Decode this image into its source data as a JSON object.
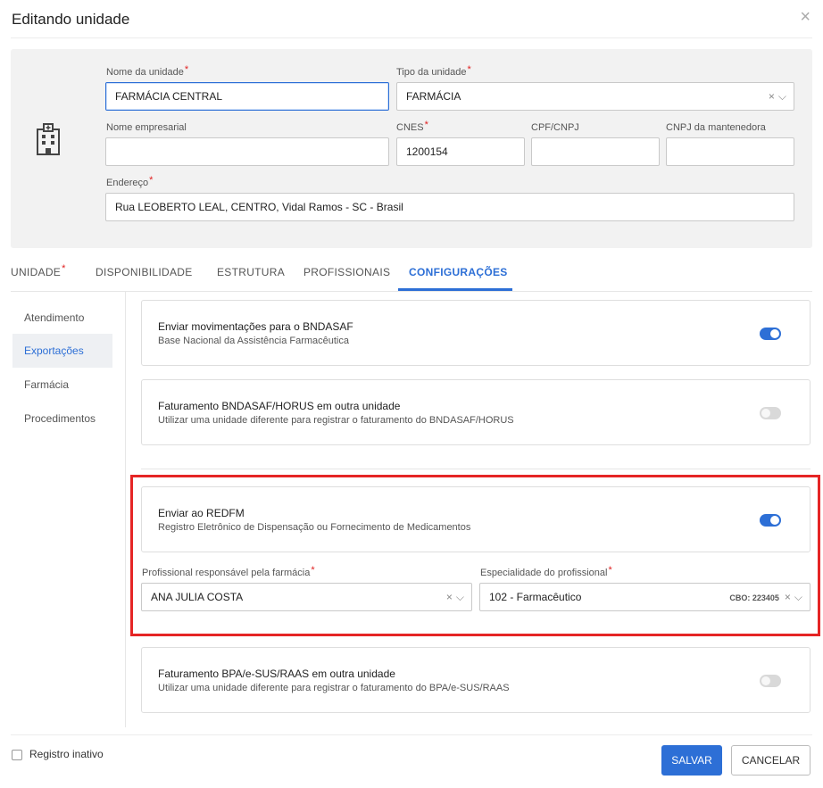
{
  "dialog": {
    "title": "Editando unidade",
    "close_glyph": "×"
  },
  "unit": {
    "icon": "hospital-building-icon",
    "nome_label": "Nome da unidade",
    "nome_value": "FARMÁCIA CENTRAL",
    "tipo_label": "Tipo da unidade",
    "tipo_value": "FARMÁCIA",
    "nome_empresarial_label": "Nome empresarial",
    "nome_empresarial_value": "",
    "cnes_label": "CNES",
    "cnes_value": "1200154",
    "cpf_cnpj_label": "CPF/CNPJ",
    "cpf_cnpj_value": "",
    "cnpj_mantenedora_label": "CNPJ da mantenedora",
    "cnpj_mantenedora_value": "",
    "endereco_label": "Endereço",
    "endereco_value": "Rua LEOBERTO LEAL, CENTRO, Vidal Ramos - SC - Brasil"
  },
  "tabs": {
    "unidade": "UNIDADE",
    "disponibilidade": "DISPONIBILIDADE",
    "estrutura": "ESTRUTURA",
    "profissionais": "PROFISSIONAIS",
    "configuracoes": "CONFIGURAÇÕES"
  },
  "sidebar": {
    "items": [
      {
        "label": "Atendimento"
      },
      {
        "label": "Exportações"
      },
      {
        "label": "Farmácia"
      },
      {
        "label": "Procedimentos"
      }
    ]
  },
  "configs": {
    "bndasaf": {
      "title": "Enviar movimentações para o BNDASAF",
      "subtitle": "Base Nacional da Assistência Farmacêutica",
      "enabled": true
    },
    "faturamento_bndasaf": {
      "title": "Faturamento BNDASAF/HORUS em outra unidade",
      "subtitle": "Utilizar uma unidade diferente para registrar o faturamento do BNDASAF/HORUS",
      "enabled": false
    },
    "redfm": {
      "title": "Enviar ao REDFM",
      "subtitle": "Registro Eletrônico de Dispensação ou Fornecimento de Medicamentos",
      "enabled": true
    },
    "profissional_label": "Profissional responsável pela farmácia",
    "profissional_value": "ANA JULIA COSTA",
    "especialidade_label": "Especialidade do profissional",
    "especialidade_value": "102 - Farmacêutico",
    "cbo_text": "CBO: 223405",
    "faturamento_bpa": {
      "title": "Faturamento BPA/e-SUS/RAAS em outra unidade",
      "subtitle": "Utilizar uma unidade diferente para registrar o faturamento do BPA/e-SUS/RAAS",
      "enabled": false
    }
  },
  "glyphs": {
    "clear": "×",
    "chevron": "⌵",
    "required": "*"
  },
  "footer": {
    "registro_inativo": "Registro inativo",
    "salvar": "SALVAR",
    "cancelar": "CANCELAR"
  },
  "colors": {
    "accent": "#2d6fd6",
    "required": "#e02020",
    "highlight_box": "#e52525"
  }
}
